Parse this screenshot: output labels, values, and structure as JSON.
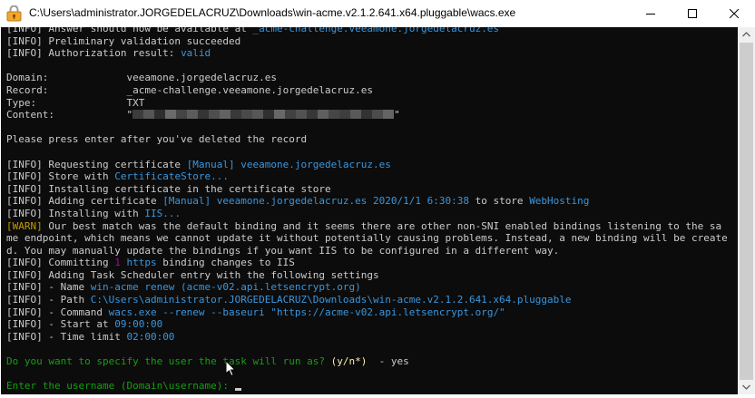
{
  "window": {
    "title": "C:\\Users\\administrator.JORGEDELACRUZ\\Downloads\\win-acme.v2.1.2.641.x64.pluggable\\wacs.exe",
    "icon": "key-icon",
    "controls": [
      "minimize-icon",
      "maximize-icon",
      "close-icon"
    ]
  },
  "console": {
    "lines": [
      [
        {
          "t": "[INFO] Answer should now be available at ",
          "c": "white"
        },
        {
          "t": "_acme-challenge.veeamone.jorgedelacruz.es",
          "c": "cyan"
        }
      ],
      [
        {
          "t": "[INFO] Preliminary validation succeeded",
          "c": "white"
        }
      ],
      [
        {
          "t": "[INFO] Authorization result: ",
          "c": "white"
        },
        {
          "t": "valid",
          "c": "cyan"
        }
      ],
      [
        {
          "t": "",
          "c": "white"
        }
      ],
      [
        {
          "t": "Domain:             veeamone.jorgedelacruz.es",
          "c": "white"
        }
      ],
      [
        {
          "t": "Record:             _acme-challenge.veeamone.jorgedelacruz.es",
          "c": "white"
        }
      ],
      [
        {
          "t": "Type:               TXT",
          "c": "white"
        }
      ],
      [
        {
          "t": "Content:            \"",
          "c": "white"
        },
        {
          "t": "REDACTED",
          "c": "redact"
        },
        {
          "t": "\"",
          "c": "white"
        }
      ],
      [
        {
          "t": "",
          "c": "white"
        }
      ],
      [
        {
          "t": "Please press enter after you've deleted the record",
          "c": "white"
        }
      ],
      [
        {
          "t": "",
          "c": "white"
        }
      ],
      [
        {
          "t": "[INFO] Requesting certificate ",
          "c": "white"
        },
        {
          "t": "[Manual] veeamone.jorgedelacruz.es",
          "c": "cyan"
        }
      ],
      [
        {
          "t": "[INFO] Store with ",
          "c": "white"
        },
        {
          "t": "CertificateStore...",
          "c": "cyan"
        }
      ],
      [
        {
          "t": "[INFO] Installing certificate in the certificate store",
          "c": "white"
        }
      ],
      [
        {
          "t": "[INFO] Adding certificate ",
          "c": "white"
        },
        {
          "t": "[Manual] veeamone.jorgedelacruz.es 2020/1/1 6:30:38",
          "c": "cyan"
        },
        {
          "t": " to store ",
          "c": "white"
        },
        {
          "t": "WebHosting",
          "c": "cyan"
        }
      ],
      [
        {
          "t": "[INFO] Installing with ",
          "c": "white"
        },
        {
          "t": "IIS...",
          "c": "cyan"
        }
      ],
      [
        {
          "t": "[WARN]",
          "c": "warn"
        },
        {
          "t": " Our best match was the default binding and it seems there are other non-SNI enabled bindings listening to the sa",
          "c": "white"
        }
      ],
      [
        {
          "t": "me endpoint, which means we cannot update it without potentially causing problems. Instead, a new binding will be create",
          "c": "white"
        }
      ],
      [
        {
          "t": "d. You may manually update the bindings if you want IIS to be configured in a different way.",
          "c": "white"
        }
      ],
      [
        {
          "t": "[INFO] Committing ",
          "c": "white"
        },
        {
          "t": "1",
          "c": "mag"
        },
        {
          "t": " ",
          "c": "white"
        },
        {
          "t": "https",
          "c": "cyan"
        },
        {
          "t": " binding changes to IIS",
          "c": "white"
        }
      ],
      [
        {
          "t": "[INFO] Adding Task Scheduler entry with the following settings",
          "c": "white"
        }
      ],
      [
        {
          "t": "[INFO] - Name ",
          "c": "white"
        },
        {
          "t": "win-acme renew (acme-v02.api.letsencrypt.org)",
          "c": "cyan"
        }
      ],
      [
        {
          "t": "[INFO] - Path ",
          "c": "white"
        },
        {
          "t": "C:\\Users\\administrator.JORGEDELACRUZ\\Downloads\\win-acme.v2.1.2.641.x64.pluggable",
          "c": "cyan"
        }
      ],
      [
        {
          "t": "[INFO] - Command ",
          "c": "white"
        },
        {
          "t": "wacs.exe --renew --baseuri \"https://acme-v02.api.letsencrypt.org/\"",
          "c": "cyan"
        }
      ],
      [
        {
          "t": "[INFO] - Start at ",
          "c": "white"
        },
        {
          "t": "09:00:00",
          "c": "cyan"
        }
      ],
      [
        {
          "t": "[INFO] - Time limit ",
          "c": "white"
        },
        {
          "t": "02:00:00",
          "c": "cyan"
        }
      ],
      [
        {
          "t": "",
          "c": "white"
        }
      ],
      [
        {
          "t": "Do you want to specify the user the task will run as? ",
          "c": "green"
        },
        {
          "t": "(y/n*)",
          "c": "yellow"
        },
        {
          "t": "  - yes",
          "c": "white"
        }
      ],
      [
        {
          "t": "",
          "c": "white"
        }
      ],
      [
        {
          "t": "Enter the username (Domain\\username): ",
          "c": "green"
        },
        {
          "t": "",
          "c": "cursor"
        }
      ]
    ]
  },
  "colors": {
    "console_bg": "#0c0c0c",
    "text": "#cccccc",
    "highlight": "#3a96dd",
    "prompt": "#13a10e",
    "options": "#f9f1a5",
    "warn": "#c19c00",
    "number": "#b4009e"
  }
}
